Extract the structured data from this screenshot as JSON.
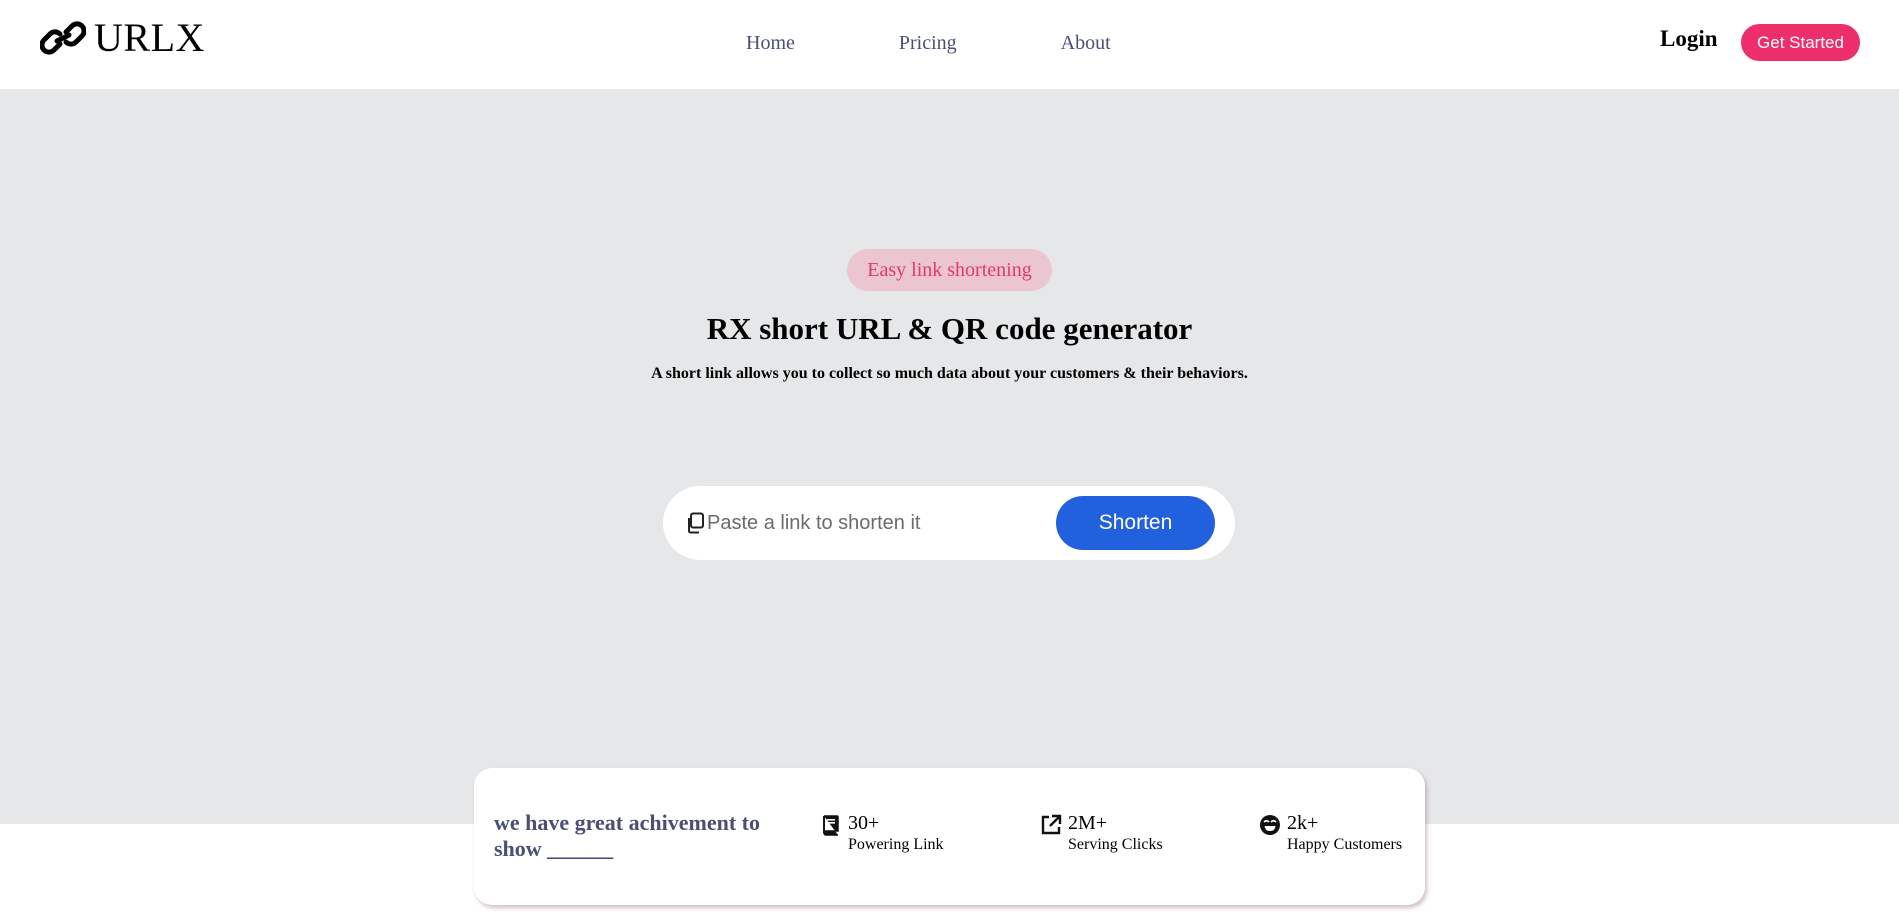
{
  "header": {
    "brand": "URLX",
    "nav": [
      {
        "label": "Home"
      },
      {
        "label": "Pricing"
      },
      {
        "label": "About"
      }
    ],
    "login_label": "Login",
    "cta_label": "Get Started"
  },
  "hero": {
    "badge": "Easy link shortening",
    "title": "RX short URL & QR code generator",
    "subtitle": "A short link allows you to collect so much data about your customers & their behaviors.",
    "input_placeholder": "Paste a link to shorten it",
    "input_value": "",
    "button_label": "Shorten"
  },
  "achievements": {
    "title": "we have great achivement to show ______",
    "stats": [
      {
        "icon": "book-icon",
        "value": "30+",
        "label": "Powering Link"
      },
      {
        "icon": "external-link-icon",
        "value": "2M+",
        "label": "Serving Clicks"
      },
      {
        "icon": "smile-icon",
        "value": "2k+",
        "label": "Happy Customers"
      }
    ]
  },
  "colors": {
    "accent_pink": "#ec2f6b",
    "badge_bg": "#ebc5cf",
    "primary_blue": "#2261dd",
    "hero_bg": "#e6e7e9",
    "nav_text": "#4b4f76"
  }
}
